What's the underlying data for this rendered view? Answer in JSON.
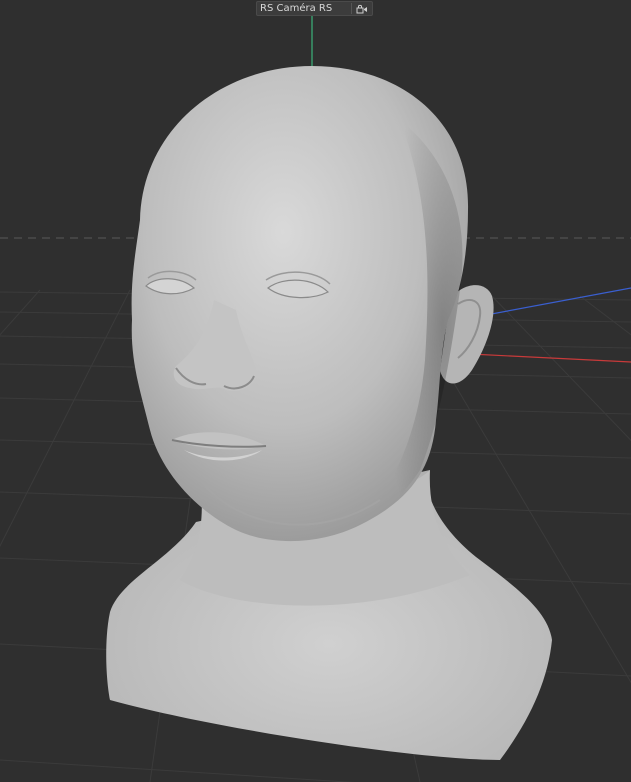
{
  "viewport": {
    "camera_label": "RS Caméra RS",
    "lock_icon": "camera-lock-icon",
    "object": "head-sculpt",
    "colors": {
      "background": "#2f2f2f",
      "grid": "#3a3a3a",
      "axis_x": "#c83a3a",
      "axis_y": "#3bb37a",
      "axis_z": "#3a5fd0",
      "horizon": "#5a5a5a"
    }
  }
}
